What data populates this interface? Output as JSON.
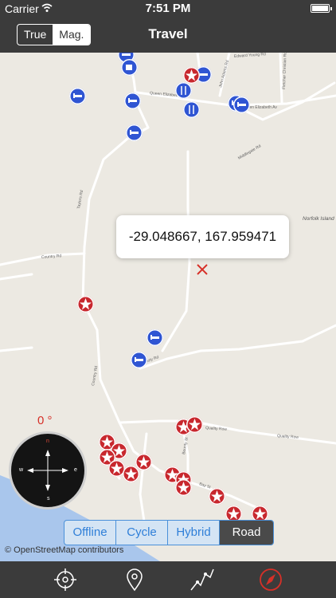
{
  "status": {
    "carrier": "Carrier",
    "time": "7:51 PM"
  },
  "header": {
    "title": "Travel",
    "bearing_options": [
      "True",
      "Mag."
    ],
    "bearing_selected": "Mag."
  },
  "map": {
    "callout": "-29.048667, 167.959471",
    "streets": [
      "Edward Young Rd",
      "John Adams Rd",
      "Fletcher Christian Rd",
      "Queen Elizabeth Av",
      "Queen Elizabeth Av",
      "Middlegate Rd",
      "Taylors Rd",
      "Country Rd",
      "Country Rd",
      "Rooty Rd",
      "Quality Row",
      "Quality Row",
      "Bounty St",
      "Bay St",
      "Norfolk Island"
    ],
    "attribution": "© OpenStreetMap contributors"
  },
  "compass": {
    "heading": "0 °",
    "labels": {
      "n": "n",
      "s": "s",
      "e": "e",
      "w": "w"
    }
  },
  "map_type": {
    "options": [
      "Offline",
      "Cycle",
      "Hybrid",
      "Road"
    ],
    "selected": "Road"
  },
  "tabs": [
    {
      "name": "locate-tab",
      "icon": "crosshair-icon"
    },
    {
      "name": "pin-tab",
      "icon": "map-pin-icon"
    },
    {
      "name": "route-tab",
      "icon": "route-icon"
    },
    {
      "name": "compass-tab",
      "icon": "compass-icon",
      "active": true
    }
  ],
  "colors": {
    "accent": "#2f7fd8",
    "bar": "#3b3b3b",
    "marker_red": "#c8282e",
    "marker_blue": "#2f55d3"
  }
}
